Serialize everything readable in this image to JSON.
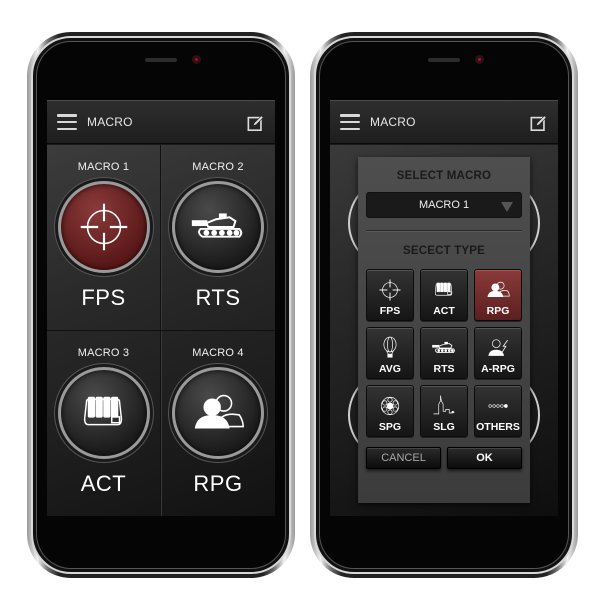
{
  "left_phone": {
    "appbar": {
      "title": "MACRO",
      "menu_icon": "hamburger-icon",
      "edit_icon": "edit-icon"
    },
    "macros": [
      {
        "label": "MACRO 1",
        "type": "FPS",
        "icon": "crosshair-icon",
        "active": true
      },
      {
        "label": "MACRO 2",
        "type": "RTS",
        "icon": "tank-icon",
        "active": false
      },
      {
        "label": "MACRO 3",
        "type": "ACT",
        "icon": "keyboard-keys-icon",
        "active": false
      },
      {
        "label": "MACRO 4",
        "type": "RPG",
        "icon": "users-icon",
        "active": false
      }
    ]
  },
  "right_phone": {
    "appbar": {
      "title": "MACRO",
      "menu_icon": "hamburger-icon",
      "edit_icon": "edit-icon"
    },
    "dialog": {
      "select_macro_title": "SELECT MACRO",
      "selected_macro": "MACRO 1",
      "select_type_title": "SECECT TYPE",
      "types": [
        {
          "label": "FPS",
          "icon": "crosshair-icon",
          "selected": false
        },
        {
          "label": "ACT",
          "icon": "keyboard-keys-icon",
          "selected": false
        },
        {
          "label": "RPG",
          "icon": "users-icon",
          "selected": true
        },
        {
          "label": "AVG",
          "icon": "hot-air-balloon-icon",
          "selected": false
        },
        {
          "label": "RTS",
          "icon": "tank-icon",
          "selected": false
        },
        {
          "label": "A-RPG",
          "icon": "user-lightning-icon",
          "selected": false
        },
        {
          "label": "SPG",
          "icon": "film-reel-icon",
          "selected": false
        },
        {
          "label": "SLG",
          "icon": "city-skyline-icon",
          "selected": false
        },
        {
          "label": "OTHERS",
          "icon": "dots-icon",
          "selected": false
        }
      ],
      "cancel_label": "CANCEL",
      "ok_label": "OK"
    }
  },
  "colors": {
    "accent_red": "#6e2424",
    "background": "#1a1a1a",
    "text": "#ffffff"
  }
}
